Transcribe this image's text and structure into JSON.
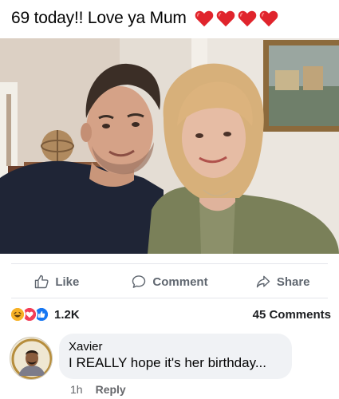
{
  "post": {
    "caption": "69 today!! Love ya Mum",
    "emoji": [
      "red-heart",
      "red-heart",
      "red-heart",
      "red-heart"
    ]
  },
  "photo": {
    "description_icon": "photo-icon"
  },
  "actions": {
    "like_label": "Like",
    "comment_label": "Comment",
    "share_label": "Share"
  },
  "summary": {
    "reaction_icons": [
      "haha-icon",
      "love-icon",
      "like-icon"
    ],
    "reaction_count": "1.2K",
    "comments_count": "45 Comments"
  },
  "comment": {
    "author": "Xavier",
    "text": "I REALLY hope it's her birthday...",
    "time": "1h",
    "reply_label": "Reply"
  },
  "colors": {
    "heart": "#e0242c",
    "like_blue": "#1877f2",
    "love_red": "#f33e58",
    "haha_yellow": "#f7b125",
    "action_grey": "#606770"
  }
}
